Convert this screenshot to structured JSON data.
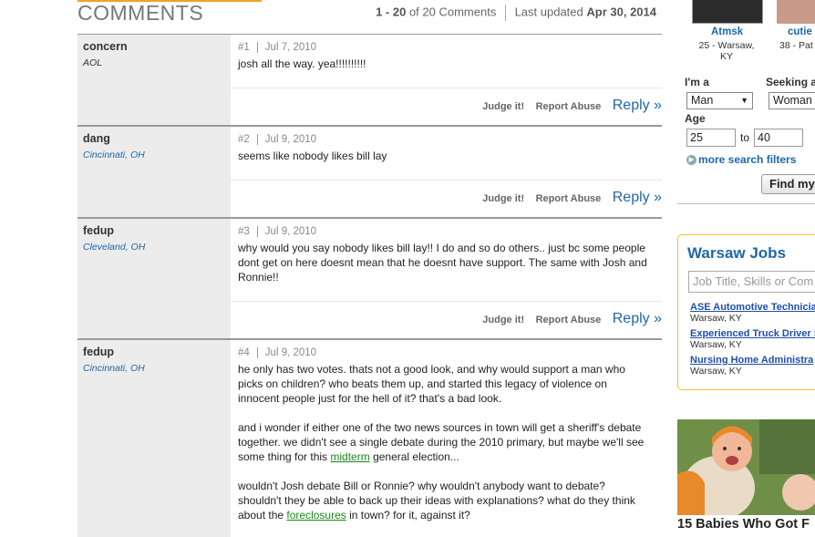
{
  "header": {
    "title": "COMMENTS",
    "range": "1 - 20",
    "of_text": "of 20 Comments",
    "updated_label": "Last updated",
    "updated_date": "Apr 30, 2014"
  },
  "actions": {
    "judge": "Judge it!",
    "report": "Report Abuse",
    "reply": "Reply »"
  },
  "comments": [
    {
      "name": "concern",
      "location": "AOL",
      "num": "#1",
      "date": "Jul 7, 2010",
      "paragraphs": [
        "josh all the way. yea!!!!!!!!!!"
      ]
    },
    {
      "name": "dang",
      "location": "Cincinnati, OH",
      "num": "#2",
      "date": "Jul 9, 2010",
      "paragraphs": [
        "seems like nobody likes bill lay"
      ]
    },
    {
      "name": "fedup",
      "location": "Cleveland, OH",
      "num": "#3",
      "date": "Jul 9, 2010",
      "paragraphs": [
        "why would you say nobody likes bill lay!! I do and so do others.. just bc some people dont get on here doesnt mean that he doesnt have support. The same with Josh and Ronnie!!"
      ]
    },
    {
      "name": "fedup",
      "location": "Cincinnati, OH",
      "num": "#4",
      "date": "Jul 9, 2010",
      "p1": "he only has two votes. thats not a good look, and why would support a man who picks on children? who beats them up, and started this legacy of violence on innocent people just for the hell of it? that's a bad look.",
      "p2_a": "and i wonder if either one of the two news sources in town will get a sheriff's debate together. we didn't see a single debate during the 2010 primary, but maybe we'll see some thing for this ",
      "p2_link": "midterm",
      "p2_b": " general election...",
      "p3_a": "wouldn't Josh debate Bill or Ronnie? why wouldn't anybody want to debate? shouldn't they be able to back up their ideas with explanations? what do they think about the ",
      "p3_link": "foreclosures",
      "p3_b": " in town? for it, against it?"
    }
  ],
  "sidebar": {
    "profiles": [
      {
        "name": "Atmsk",
        "info_line1": "25 - Warsaw,",
        "info_line2": "KY"
      },
      {
        "name": "cutie",
        "info_line1": "38 - Pat",
        "info_line2": ""
      }
    ],
    "im_a_label": "I'm a",
    "im_a_value": "Man",
    "seeking_label": "Seeking a",
    "seeking_value": "Woman",
    "age_label": "Age",
    "age_from": "25",
    "age_to_label": "to",
    "age_to": "40",
    "more_filters": "more search filters",
    "find_button": "Find my",
    "jobs_title": "Warsaw Jobs",
    "jobs_placeholder": "Job Title, Skills or Com",
    "jobs": [
      {
        "title": "ASE Automotive Technicia",
        "location": "Warsaw, KY"
      },
      {
        "title": "Experienced Truck Driver S",
        "location": "Warsaw, KY"
      },
      {
        "title": "Nursing Home Administra",
        "location": "Warsaw, KY"
      }
    ],
    "photo_caption": "15 Babies Who Got F"
  }
}
